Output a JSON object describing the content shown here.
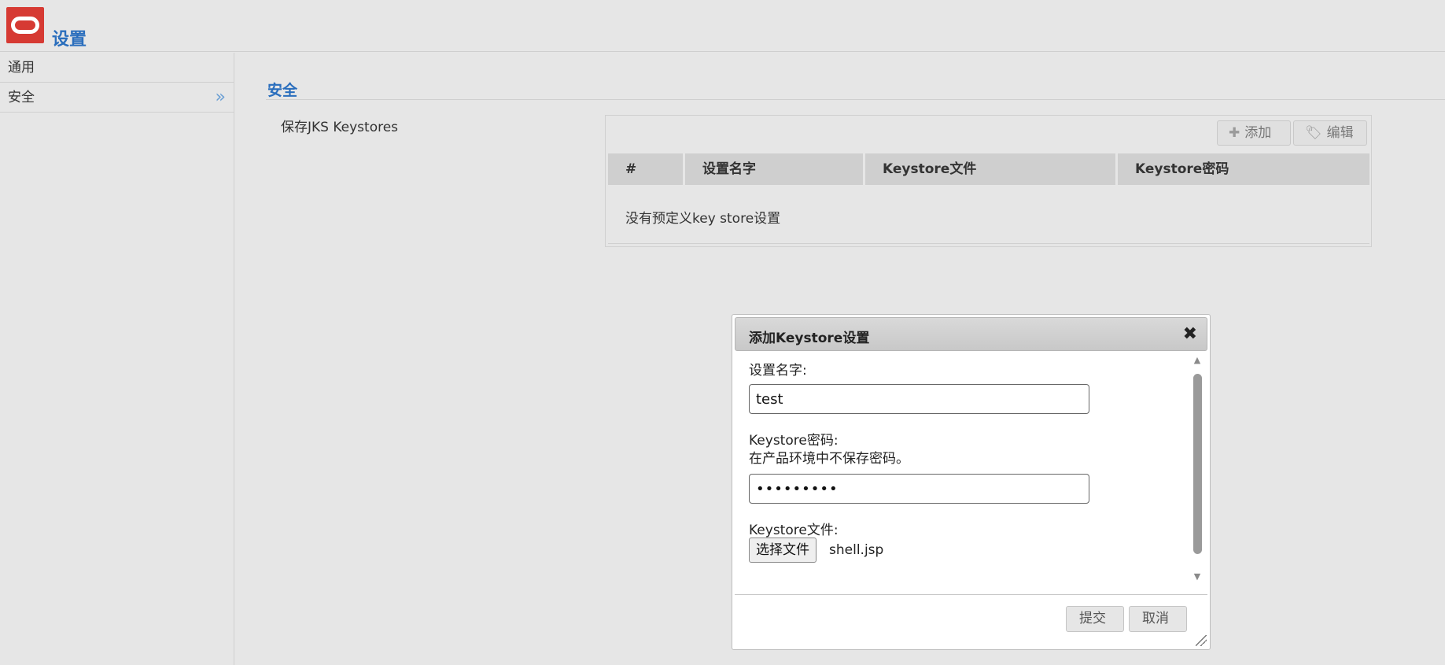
{
  "header": {
    "title": "设置"
  },
  "sidebar": {
    "items": [
      {
        "label": "通用"
      },
      {
        "label": "安全"
      }
    ],
    "active_indicator": "»"
  },
  "main": {
    "section_title": "安全",
    "jks_label": "保存JKS Keystores",
    "toolbar": {
      "add_label": "添加",
      "edit_label": "编辑"
    },
    "table": {
      "columns": [
        "#",
        "设置名字",
        "Keystore文件",
        "Keystore密码"
      ],
      "empty_message": "没有预定义key store设置"
    }
  },
  "dialog": {
    "title": "添加Keystore设置",
    "close_glyph": "✖",
    "name_label": "设置名字:",
    "name_value": "test",
    "password_label": "Keystore密码:",
    "password_note": "在产品环境中不保存密码。",
    "password_value": "•••••••••",
    "file_label": "Keystore文件:",
    "file_button": "选择文件",
    "file_name": "shell.jsp",
    "submit_label": "提交",
    "cancel_label": "取消"
  },
  "icons": {
    "add": "plus-icon",
    "edit": "tag-icon",
    "sidebar_active": "double-chevron-right-icon"
  }
}
